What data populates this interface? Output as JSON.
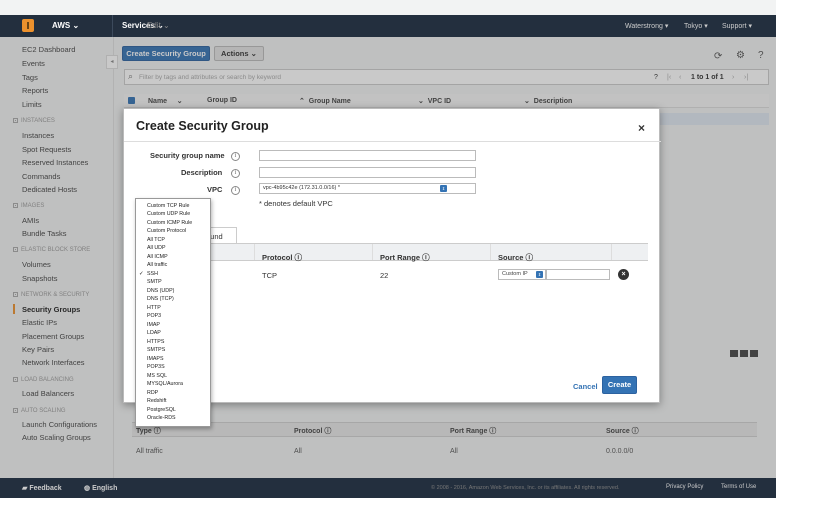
{
  "topnav": {
    "brand": "AWS",
    "services": "Services",
    "edit": "Edit",
    "account": "Waterstrong",
    "region": "Tokyo",
    "support": "Support"
  },
  "sidebar": {
    "top_items": [
      "EC2 Dashboard",
      "Events",
      "Tags",
      "Reports",
      "Limits"
    ],
    "sections": [
      {
        "title": "INSTANCES",
        "items": [
          "Instances",
          "Spot Requests",
          "Reserved Instances",
          "Commands",
          "Dedicated Hosts"
        ]
      },
      {
        "title": "IMAGES",
        "items": [
          "AMIs",
          "Bundle Tasks"
        ]
      },
      {
        "title": "ELASTIC BLOCK STORE",
        "items": [
          "Volumes",
          "Snapshots"
        ]
      },
      {
        "title": "NETWORK & SECURITY",
        "items": [
          "Security Groups",
          "Elastic IPs",
          "Placement Groups",
          "Key Pairs",
          "Network Interfaces"
        ]
      },
      {
        "title": "LOAD BALANCING",
        "items": [
          "Load Balancers"
        ]
      },
      {
        "title": "AUTO SCALING",
        "items": [
          "Launch Configurations",
          "Auto Scaling Groups"
        ]
      }
    ],
    "active_item": "Security Groups"
  },
  "toolbar": {
    "create_label": "Create Security Group",
    "actions_label": "Actions"
  },
  "search": {
    "placeholder": "Filter by tags and attributes or search by keyword"
  },
  "pagination": {
    "text": "1 to 1 of 1"
  },
  "table": {
    "columns": [
      "Name",
      "Group ID",
      "Group Name",
      "VPC ID",
      "Description"
    ]
  },
  "lower_table": {
    "columns": [
      "Type",
      "Protocol",
      "Port Range",
      "Source"
    ],
    "row": [
      "All traffic",
      "All",
      "All",
      "0.0.0.0/0"
    ]
  },
  "footer": {
    "feedback": "Feedback",
    "language": "English",
    "copyright": "© 2008 - 2016, Amazon Web Services, Inc. or its affiliates. All rights reserved.",
    "privacy": "Privacy Policy",
    "terms": "Terms of Use"
  },
  "modal": {
    "title": "Create Security Group",
    "close": "×",
    "fields": {
      "name_label": "Security group name",
      "name_value": "",
      "desc_label": "Description",
      "desc_value": "",
      "vpc_label": "VPC",
      "vpc_value": "vpc-4b95c42e (172.31.0.0/16) *",
      "vpc_note": "* denotes default VPC"
    },
    "tab_partial": "ound",
    "rules_columns": [
      "Protocol",
      "Port Range",
      "Source"
    ],
    "rule": {
      "protocol": "TCP",
      "port_range": "22",
      "source_select": "Custom IP",
      "source_value": ""
    },
    "cancel_label": "Cancel",
    "create_label": "Create"
  },
  "type_dropdown": {
    "options": [
      "Custom TCP Rule",
      "Custom UDP Rule",
      "Custom ICMP Rule",
      "Custom Protocol",
      "All TCP",
      "All UDP",
      "All ICMP",
      "All traffic",
      "SSH",
      "SMTP",
      "DNS (UDP)",
      "DNS (TCP)",
      "HTTP",
      "POP3",
      "IMAP",
      "LDAP",
      "HTTPS",
      "SMTPS",
      "IMAPS",
      "POP3S",
      "MS SQL",
      "MYSQL/Aurora",
      "RDP",
      "Redshift",
      "PostgreSQL",
      "Oracle-RDS"
    ],
    "selected": "SSH",
    "check_mark": "✓"
  },
  "colors": {
    "nav_bg": "#232f3e",
    "accent_blue": "#3473b4",
    "active_orange": "#ec912d"
  }
}
